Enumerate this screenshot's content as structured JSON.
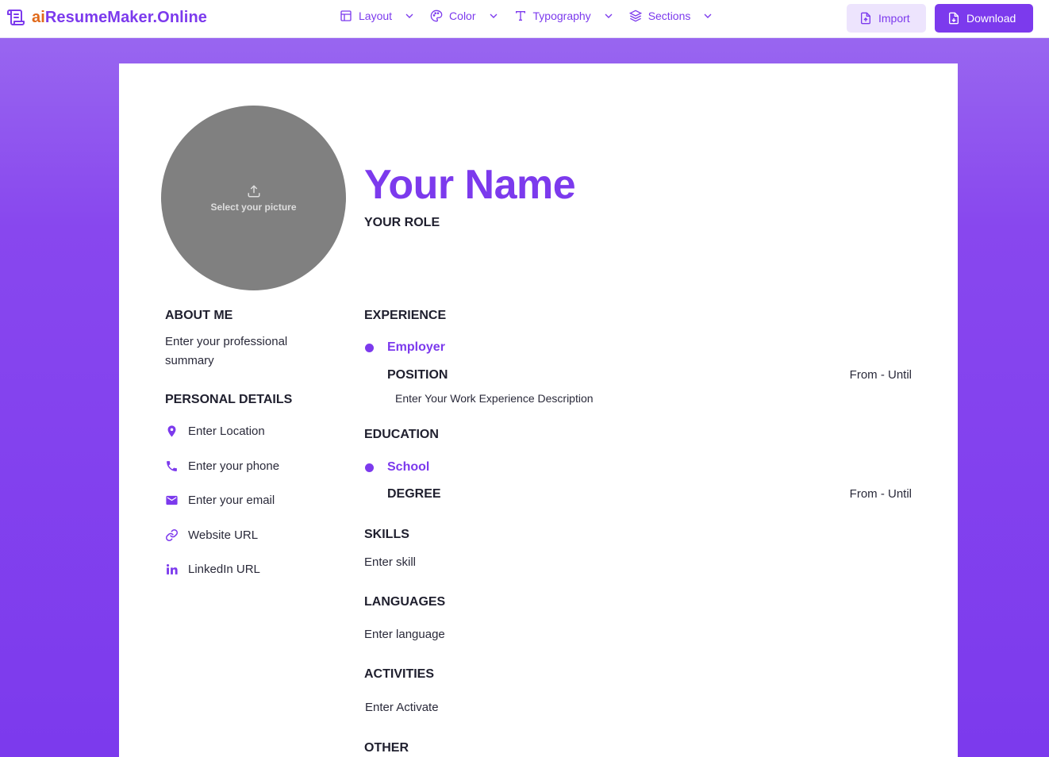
{
  "app": {
    "brand_prefix": "ai",
    "brand_rest": "ResumeMaker.Online"
  },
  "menu": [
    {
      "label": "Layout",
      "icon": "layout-icon"
    },
    {
      "label": "Color",
      "icon": "palette-icon"
    },
    {
      "label": "Typography",
      "icon": "typography-icon"
    },
    {
      "label": "Sections",
      "icon": "layers-icon"
    }
  ],
  "actions": {
    "import_label": "Import",
    "download_label": "Download"
  },
  "colors": {
    "accent": "#7c3aed",
    "brand_ai": "#e0691a",
    "photo_bg": "#808080"
  },
  "resume": {
    "photo_label": "Select your picture",
    "name": "Your Name",
    "role": "YOUR ROLE",
    "about": {
      "heading": "ABOUT ME",
      "text": "Enter your professional summary"
    },
    "personal": {
      "heading": "PERSONAL DETAILS",
      "location": "Enter Location",
      "phone": "Enter your phone",
      "email": "Enter your email",
      "website": "Website URL",
      "linkedin": "LinkedIn URL"
    },
    "experience": {
      "heading": "EXPERIENCE",
      "employer": "Employer",
      "position": "POSITION",
      "dates": "From - Until",
      "description": "Enter Your Work Experience Description"
    },
    "education": {
      "heading": "EDUCATION",
      "school": "School",
      "degree": "DEGREE",
      "dates": "From - Until"
    },
    "skills": {
      "heading": "SKILLS",
      "text": "Enter skill"
    },
    "languages": {
      "heading": "LANGUAGES",
      "text": "Enter language"
    },
    "activities": {
      "heading": "ACTIVITIES",
      "text": "Enter Activate"
    },
    "other": {
      "heading": "OTHER"
    }
  }
}
